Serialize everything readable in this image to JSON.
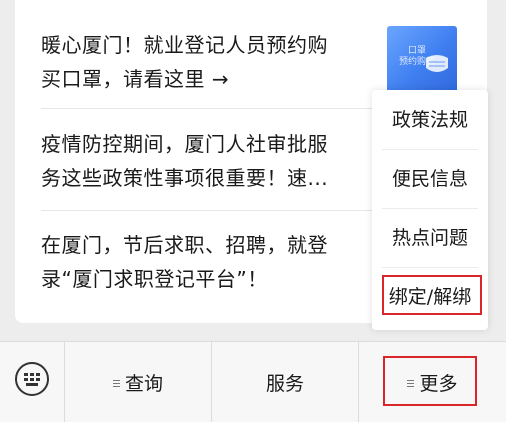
{
  "articles": [
    {
      "line1": "暖心厦门！就业登记人员预约购",
      "line2": "买口罩，请看这里 →"
    },
    {
      "line1": "疫情防控期间，厦门人社审批服",
      "line2": "务这些政策性事项很重要！速..."
    },
    {
      "line1": "在厦门，节后求职、招聘，就登",
      "line2": "录“厦门求职登记平台”！"
    }
  ],
  "thumbnail": {
    "text": "口罩\n预约购买"
  },
  "more_menu": {
    "items": [
      {
        "label": "政策法规"
      },
      {
        "label": "便民信息"
      },
      {
        "label": "热点问题"
      },
      {
        "label": "绑定/解绑"
      }
    ]
  },
  "tabbar": {
    "tabs": [
      {
        "label": "查询"
      },
      {
        "label": "服务"
      },
      {
        "label": "更多"
      }
    ]
  },
  "colors": {
    "highlight": "#d9262b",
    "thumbnail": "#3f7ef0"
  }
}
